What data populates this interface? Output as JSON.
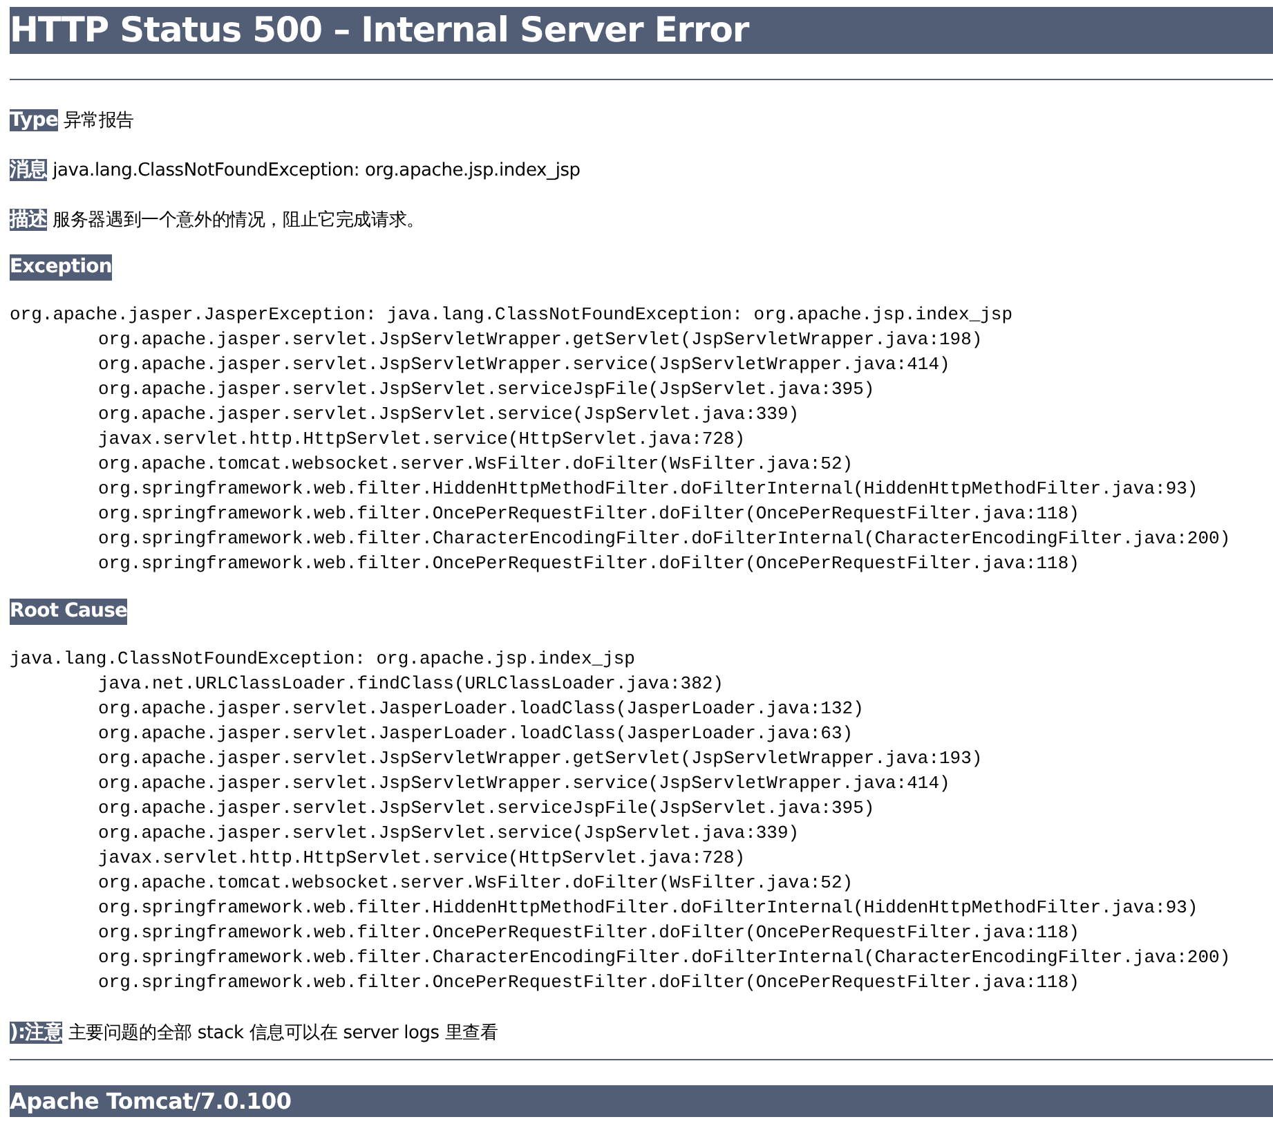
{
  "title": "HTTP Status 500 – Internal Server Error",
  "fields": [
    {
      "label": "Type",
      "text": "异常报告"
    },
    {
      "label": "消息",
      "text": "java.lang.ClassNotFoundException: org.apache.jsp.index_jsp"
    },
    {
      "label": "描述",
      "text": "服务器遇到一个意外的情况，阻止它完成请求。"
    }
  ],
  "sections": [
    {
      "heading": "Exception",
      "head": "org.apache.jasper.JasperException: java.lang.ClassNotFoundException: org.apache.jsp.index_jsp",
      "frames": [
        "org.apache.jasper.servlet.JspServletWrapper.getServlet(JspServletWrapper.java:198)",
        "org.apache.jasper.servlet.JspServletWrapper.service(JspServletWrapper.java:414)",
        "org.apache.jasper.servlet.JspServlet.serviceJspFile(JspServlet.java:395)",
        "org.apache.jasper.servlet.JspServlet.service(JspServlet.java:339)",
        "javax.servlet.http.HttpServlet.service(HttpServlet.java:728)",
        "org.apache.tomcat.websocket.server.WsFilter.doFilter(WsFilter.java:52)",
        "org.springframework.web.filter.HiddenHttpMethodFilter.doFilterInternal(HiddenHttpMethodFilter.java:93)",
        "org.springframework.web.filter.OncePerRequestFilter.doFilter(OncePerRequestFilter.java:118)",
        "org.springframework.web.filter.CharacterEncodingFilter.doFilterInternal(CharacterEncodingFilter.java:200)",
        "org.springframework.web.filter.OncePerRequestFilter.doFilter(OncePerRequestFilter.java:118)"
      ]
    },
    {
      "heading": "Root Cause",
      "head": "java.lang.ClassNotFoundException: org.apache.jsp.index_jsp",
      "frames": [
        "java.net.URLClassLoader.findClass(URLClassLoader.java:382)",
        "org.apache.jasper.servlet.JasperLoader.loadClass(JasperLoader.java:132)",
        "org.apache.jasper.servlet.JasperLoader.loadClass(JasperLoader.java:63)",
        "org.apache.jasper.servlet.JspServletWrapper.getServlet(JspServletWrapper.java:193)",
        "org.apache.jasper.servlet.JspServletWrapper.service(JspServletWrapper.java:414)",
        "org.apache.jasper.servlet.JspServlet.serviceJspFile(JspServlet.java:395)",
        "org.apache.jasper.servlet.JspServlet.service(JspServlet.java:339)",
        "javax.servlet.http.HttpServlet.service(HttpServlet.java:728)",
        "org.apache.tomcat.websocket.server.WsFilter.doFilter(WsFilter.java:52)",
        "org.springframework.web.filter.HiddenHttpMethodFilter.doFilterInternal(HiddenHttpMethodFilter.java:93)",
        "org.springframework.web.filter.OncePerRequestFilter.doFilter(OncePerRequestFilter.java:118)",
        "org.springframework.web.filter.CharacterEncodingFilter.doFilterInternal(CharacterEncodingFilter.java:200)",
        "org.springframework.web.filter.OncePerRequestFilter.doFilter(OncePerRequestFilter.java:118)"
      ]
    }
  ],
  "note": {
    "label": "):注意",
    "text": "主要问题的全部 stack 信息可以在 server logs 里查看"
  },
  "footer": "Apache Tomcat/7.0.100"
}
